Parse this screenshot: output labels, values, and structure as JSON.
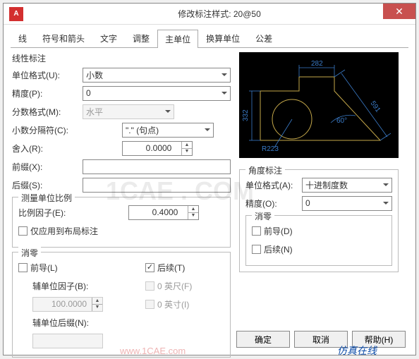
{
  "window": {
    "appIcon": "A",
    "title": "修改标注样式: 20@50",
    "close": "✕"
  },
  "tabs": [
    "线",
    "符号和箭头",
    "文字",
    "调整",
    "主单位",
    "换算单位",
    "公差"
  ],
  "activeTab": 4,
  "linear": {
    "groupTitle": "线性标注",
    "unitFormatLbl": "单位格式(U):",
    "unitFormat": "小数",
    "precisionLbl": "精度(P):",
    "precision": "0",
    "fractionFmtLbl": "分数格式(M):",
    "fractionFmt": "水平",
    "decSepLbl": "小数分隔符(C):",
    "decSep": "\".\" (句点)",
    "roundLbl": "舍入(R):",
    "round": "0.0000",
    "prefixLbl": "前缀(X):",
    "prefix": "",
    "suffixLbl": "后缀(S):",
    "suffix": ""
  },
  "scale": {
    "groupTitle": "测量单位比例",
    "factorLbl": "比例因子(E):",
    "factor": "0.4000",
    "layoutOnly": "仅应用到布局标注"
  },
  "zero": {
    "groupTitle": "消零",
    "leading": "前导(L)",
    "trailing": "后续(T)",
    "auxFactorLbl": "辅单位因子(B):",
    "auxFactor": "100.0000",
    "feet": "0 英尺(F)",
    "inch": "0 英寸(I)",
    "auxSuffixLbl": "辅单位后缀(N):",
    "auxSuffix": ""
  },
  "angular": {
    "groupTitle": "角度标注",
    "unitFormatLbl": "单位格式(A):",
    "unitFormat": "十进制度数",
    "precisionLbl": "精度(O):",
    "precision": "0",
    "zeroTitle": "消零",
    "leading": "前导(D)",
    "trailing": "后续(N)"
  },
  "preview": {
    "d1": "282",
    "d2": "332",
    "d3": "591",
    "ang": "60°",
    "rad": "R223"
  },
  "buttons": {
    "ok": "确定",
    "cancel": "取消",
    "help": "帮助(H)"
  },
  "watermark": "1CAE . COM",
  "footmark": "仿真在线",
  "footurl": "www.1CAE.com"
}
